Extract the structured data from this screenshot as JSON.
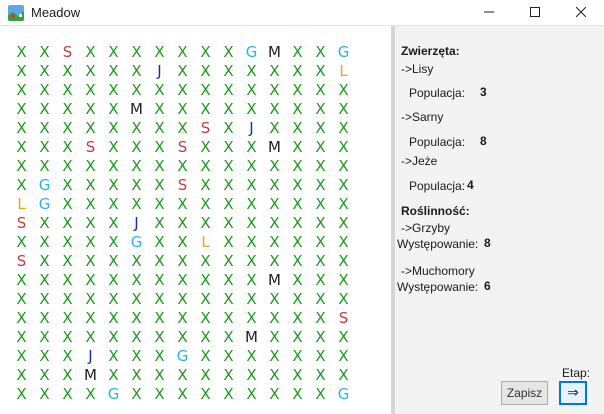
{
  "window": {
    "title": "Meadow"
  },
  "colors": {
    "X": "#1e9a1e",
    "S": "#c43b3b",
    "G": "#26b4e6",
    "J": "#1c2c9c",
    "M": "#1f1f1f",
    "L": "#f0a020"
  },
  "grid": {
    "rows": [
      "XXSXXXXXXXGMXXG",
      "XXXXXXJXXXXXXXL",
      "XXXXXXXXXXXXXXX",
      "XXXXXMXXXXXXXXX",
      "XXXXXXXXSXJXXXX",
      "XXXSXXXSXXXMXXX",
      "XXXXXXXXXXXXXXX",
      "XGXXXXXSXXXXXXX",
      "LGXXXXXXXXXXXXX",
      "SXXXXJXXXXXXXXX",
      "XXXXXGXXLXXXXXX",
      "SXXXXXXXXXXXXXX",
      "XXXXXXXXXXXMXXX",
      "XXXXXXXXXXXXXXX",
      "XXXXXXXXXXXXXXS",
      "XXXXXXXXXXMXXXX",
      "XXXJXXXGXXXXXXX",
      "XXXMXXXXXXXXXXX",
      "XXXXGXXXXXXXXXG"
    ]
  },
  "sidebar": {
    "animals_header": "Zwierzęta:",
    "foxes": "->Lisy",
    "foxes_pop_label": "Populacja:",
    "foxes_pop": "3",
    "deer": "->Sarny",
    "deer_pop_label": "Populacja:",
    "deer_pop": "8",
    "hedgehogs": "->Jeże",
    "hedgehogs_pop_label": "Populacja:",
    "hedgehogs_pop": "4",
    "plants_header": "Roślinność:",
    "mushrooms": "->Grzyby",
    "mushrooms_occ_label": "Występowanie:",
    "mushrooms_occ": "8",
    "toadstools": "->Muchomory",
    "toadstools_occ_label": "Występowanie:",
    "toadstools_occ": "6",
    "stage_label": "Etap:",
    "save_label": "Zapisz",
    "next_label": "⇒"
  }
}
